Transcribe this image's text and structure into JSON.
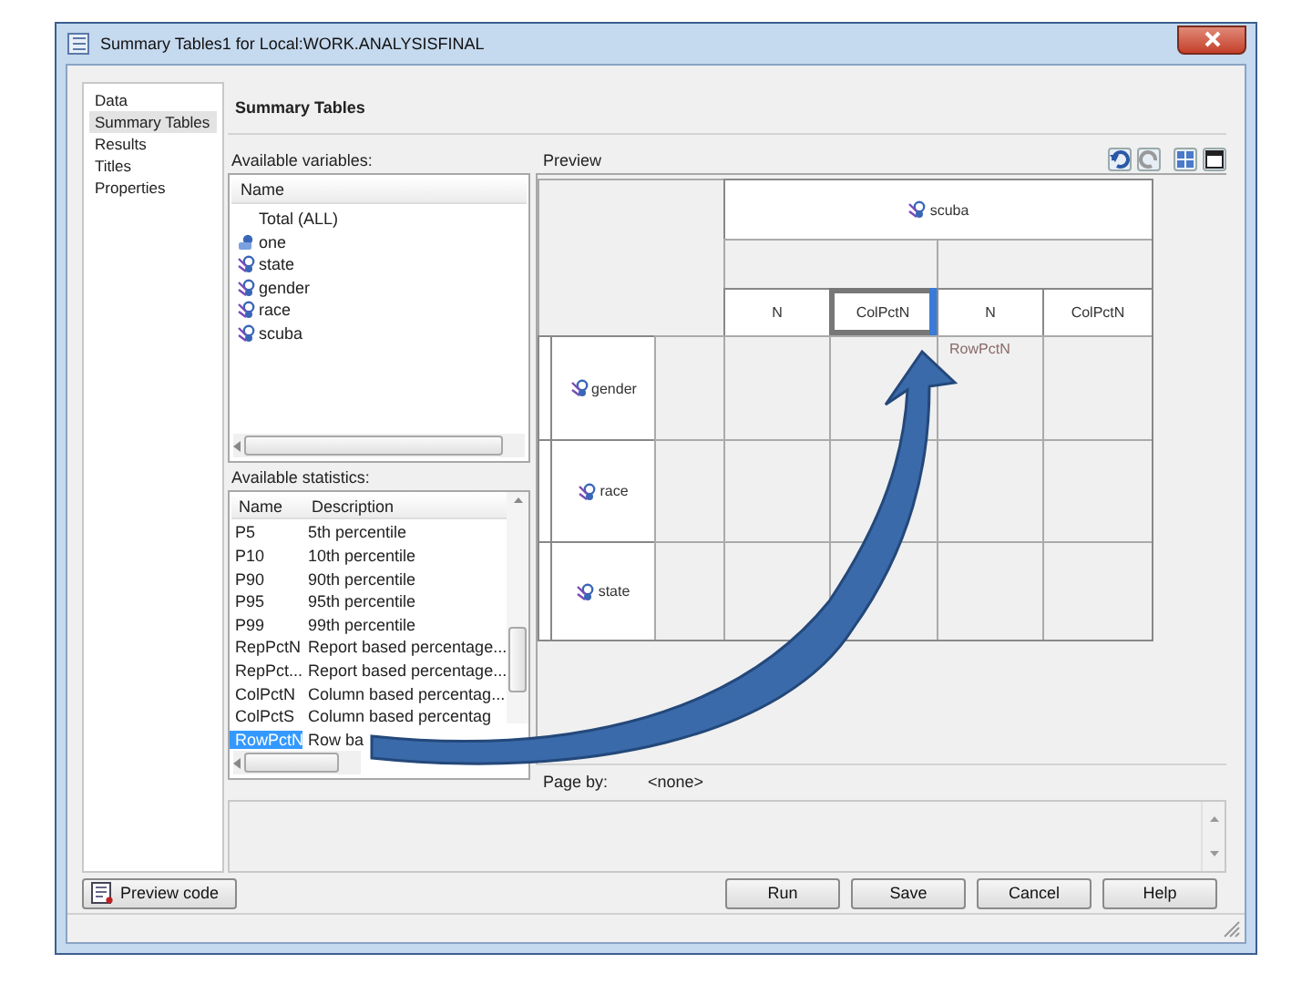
{
  "window": {
    "title": "Summary Tables1 for Local:WORK.ANALYSISFINAL"
  },
  "nav": {
    "items": [
      {
        "label": "Data",
        "selected": false
      },
      {
        "label": "Summary Tables",
        "selected": true
      },
      {
        "label": "Results",
        "selected": false
      },
      {
        "label": "Titles",
        "selected": false
      },
      {
        "label": "Properties",
        "selected": false
      }
    ]
  },
  "section_title": "Summary Tables",
  "variables": {
    "label": "Available variables:",
    "column": "Name",
    "items": [
      {
        "name": "Total (ALL)",
        "kind": "total"
      },
      {
        "name": "one",
        "kind": "numeric"
      },
      {
        "name": "state",
        "kind": "class"
      },
      {
        "name": "gender",
        "kind": "class"
      },
      {
        "name": "race",
        "kind": "class"
      },
      {
        "name": "scuba",
        "kind": "class"
      }
    ]
  },
  "statistics": {
    "label": "Available statistics:",
    "columns": [
      "Name",
      "Description"
    ],
    "rows": [
      {
        "name": "P5",
        "description": "5th percentile",
        "selected": false
      },
      {
        "name": "P10",
        "description": "10th percentile",
        "selected": false
      },
      {
        "name": "P90",
        "description": "90th percentile",
        "selected": false
      },
      {
        "name": "P95",
        "description": "95th percentile",
        "selected": false
      },
      {
        "name": "P99",
        "description": "99th percentile",
        "selected": false
      },
      {
        "name": "RepPctN",
        "description": "Report based percentage...",
        "selected": false
      },
      {
        "name": "RepPct...",
        "description": "Report based percentage...",
        "selected": false
      },
      {
        "name": "ColPctN",
        "description": "Column based percentag...",
        "selected": false
      },
      {
        "name": "ColPctS",
        "description": "Column based percentag",
        "selected": false
      },
      {
        "name": "RowPctN",
        "description": "Row ba",
        "selected": true
      }
    ]
  },
  "preview": {
    "label": "Preview",
    "column_variable": "scuba",
    "statistic_headers": [
      {
        "label": "N",
        "selected": false
      },
      {
        "label": "ColPctN",
        "selected": true
      },
      {
        "label": "N",
        "selected": false
      },
      {
        "label": "ColPctN",
        "selected": false
      }
    ],
    "drop_hint": "RowPctN",
    "row_variables": [
      "gender",
      "race",
      "state"
    ]
  },
  "page_by": {
    "label": "Page by:",
    "value": "<none>"
  },
  "footer": {
    "preview_code": "Preview code",
    "actions": [
      "Run",
      "Save",
      "Cancel",
      "Help"
    ]
  }
}
